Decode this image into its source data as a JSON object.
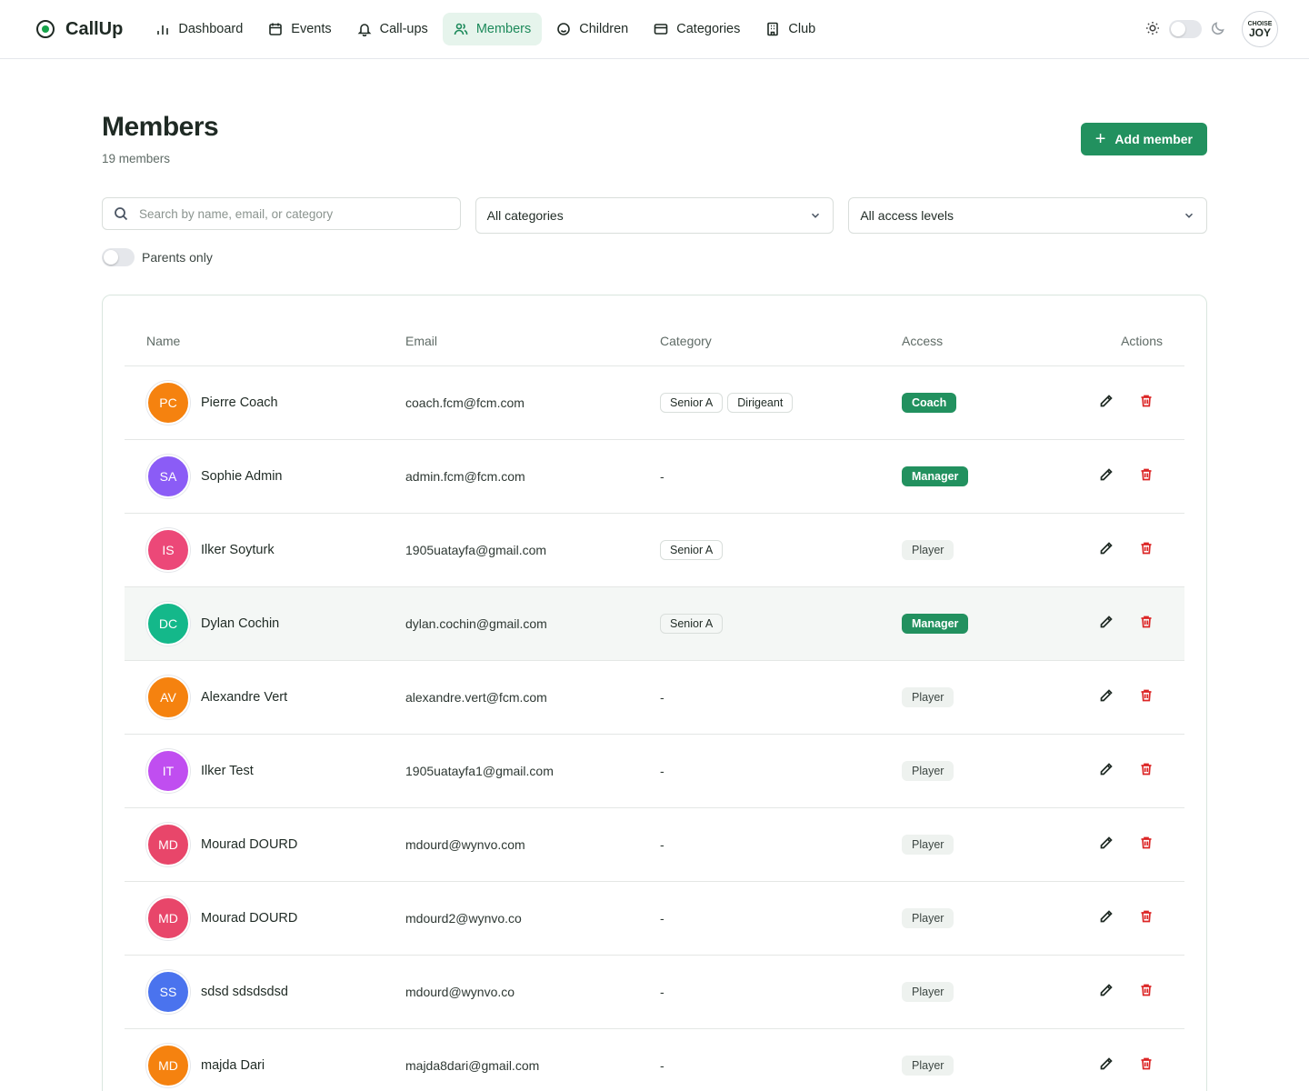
{
  "app": {
    "name": "CallUp"
  },
  "nav": {
    "items": [
      {
        "label": "Dashboard",
        "icon": "bar-chart-icon",
        "active": false
      },
      {
        "label": "Events",
        "icon": "calendar-icon",
        "active": false
      },
      {
        "label": "Call-ups",
        "icon": "bell-icon",
        "active": false
      },
      {
        "label": "Members",
        "icon": "users-icon",
        "active": true
      },
      {
        "label": "Children",
        "icon": "smile-icon",
        "active": false
      },
      {
        "label": "Categories",
        "icon": "card-icon",
        "active": false
      },
      {
        "label": "Club",
        "icon": "building-icon",
        "active": false
      }
    ]
  },
  "user_avatar": {
    "line1": "CHOISE",
    "line2": "JOY"
  },
  "page": {
    "title": "Members",
    "subtitle": "19 members",
    "add_button": "Add member"
  },
  "filters": {
    "search_placeholder": "Search by name, email, or category",
    "category_select": "All categories",
    "access_select": "All access levels",
    "parents_only": "Parents only"
  },
  "table": {
    "headers": {
      "name": "Name",
      "email": "Email",
      "category": "Category",
      "access": "Access",
      "actions": "Actions"
    },
    "rows": [
      {
        "initials": "PC",
        "name": "Pierre Coach",
        "email": "coach.fcm@fcm.com",
        "categories": [
          "Senior A",
          "Dirigeant"
        ],
        "access": "Coach",
        "access_style": "dark",
        "color": "#f5820f"
      },
      {
        "initials": "SA",
        "name": "Sophie Admin",
        "email": "admin.fcm@fcm.com",
        "categories": [],
        "access": "Manager",
        "access_style": "dark",
        "color": "#8b5cf6"
      },
      {
        "initials": "IS",
        "name": "Ilker Soyturk",
        "email": "1905uatayfa@gmail.com",
        "categories": [
          "Senior A"
        ],
        "access": "Player",
        "access_style": "light",
        "color": "#ec4878"
      },
      {
        "initials": "DC",
        "name": "Dylan Cochin",
        "email": "dylan.cochin@gmail.com",
        "categories": [
          "Senior A"
        ],
        "access": "Manager",
        "access_style": "dark",
        "color": "#14b88a"
      },
      {
        "initials": "AV",
        "name": "Alexandre Vert",
        "email": "alexandre.vert@fcm.com",
        "categories": [],
        "access": "Player",
        "access_style": "light",
        "color": "#f5820f"
      },
      {
        "initials": "IT",
        "name": "Ilker Test",
        "email": "1905uatayfa1@gmail.com",
        "categories": [],
        "access": "Player",
        "access_style": "light",
        "color": "#c04ef0"
      },
      {
        "initials": "MD",
        "name": "Mourad DOURD",
        "email": "mdourd@wynvo.com",
        "categories": [],
        "access": "Player",
        "access_style": "light",
        "color": "#e8466a"
      },
      {
        "initials": "MD",
        "name": "Mourad DOURD",
        "email": "mdourd2@wynvo.co",
        "categories": [],
        "access": "Player",
        "access_style": "light",
        "color": "#e8466a"
      },
      {
        "initials": "SS",
        "name": "sdsd sdsdsdsd",
        "email": "mdourd@wynvo.co",
        "categories": [],
        "access": "Player",
        "access_style": "light",
        "color": "#4a73ee"
      },
      {
        "initials": "MD",
        "name": "majda Dari",
        "email": "majda8dari@gmail.com",
        "categories": [],
        "access": "Player",
        "access_style": "light",
        "color": "#f5820f"
      }
    ],
    "empty_category": "-",
    "highlighted_row": 3
  }
}
